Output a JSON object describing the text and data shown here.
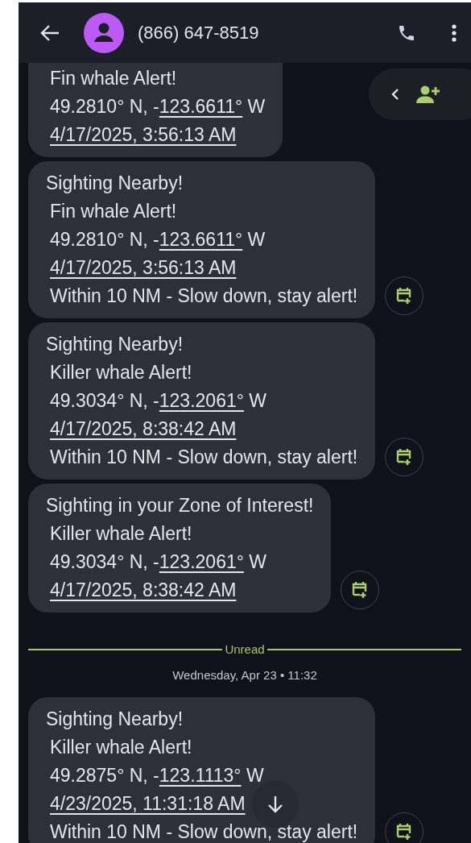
{
  "header": {
    "contact": "(866) 647-8519"
  },
  "conversation": [
    {
      "kind": "message",
      "species": "Fin whale Alert!",
      "coords": {
        "prefix": "49.2810° N, -",
        "link": "123.6611°",
        "suffix": " W"
      },
      "timestamp": "4/17/2025, 3:56:13 AM",
      "has_calendar_button": false
    },
    {
      "kind": "message",
      "title": "Sighting Nearby!",
      "species": "Fin whale Alert!",
      "coords": {
        "prefix": "49.2810° N, -",
        "link": "123.6611°",
        "suffix": " W"
      },
      "timestamp": "4/17/2025, 3:56:13 AM",
      "note": "Within 10 NM - Slow down, stay alert!",
      "has_calendar_button": true
    },
    {
      "kind": "message",
      "title": "Sighting Nearby!",
      "species": "Killer whale Alert!",
      "coords": {
        "prefix": "49.3034° N, -",
        "link": "123.2061°",
        "suffix": " W"
      },
      "timestamp": "4/17/2025, 8:38:42 AM",
      "note": "Within 10 NM - Slow down, stay alert!",
      "has_calendar_button": true
    },
    {
      "kind": "message",
      "title": "Sighting in your Zone of Interest!",
      "species": "Killer whale Alert!",
      "coords": {
        "prefix": "49.3034° N, -",
        "link": "123.2061°",
        "suffix": " W"
      },
      "timestamp": "4/17/2025, 8:38:42 AM",
      "has_calendar_button": true
    },
    {
      "kind": "divider",
      "label": "Unread"
    },
    {
      "kind": "date",
      "label": "Wednesday, Apr 23 • 11:32"
    },
    {
      "kind": "message",
      "title": "Sighting Nearby!",
      "species": "Killer whale Alert!",
      "coords": {
        "prefix": "49.2875° N, -",
        "link": "123.1113°",
        "suffix": " W"
      },
      "timestamp": "4/23/2025, 11:31:18 AM",
      "note": "Within 10 NM - Slow down, stay alert!",
      "has_calendar_button": true
    }
  ]
}
